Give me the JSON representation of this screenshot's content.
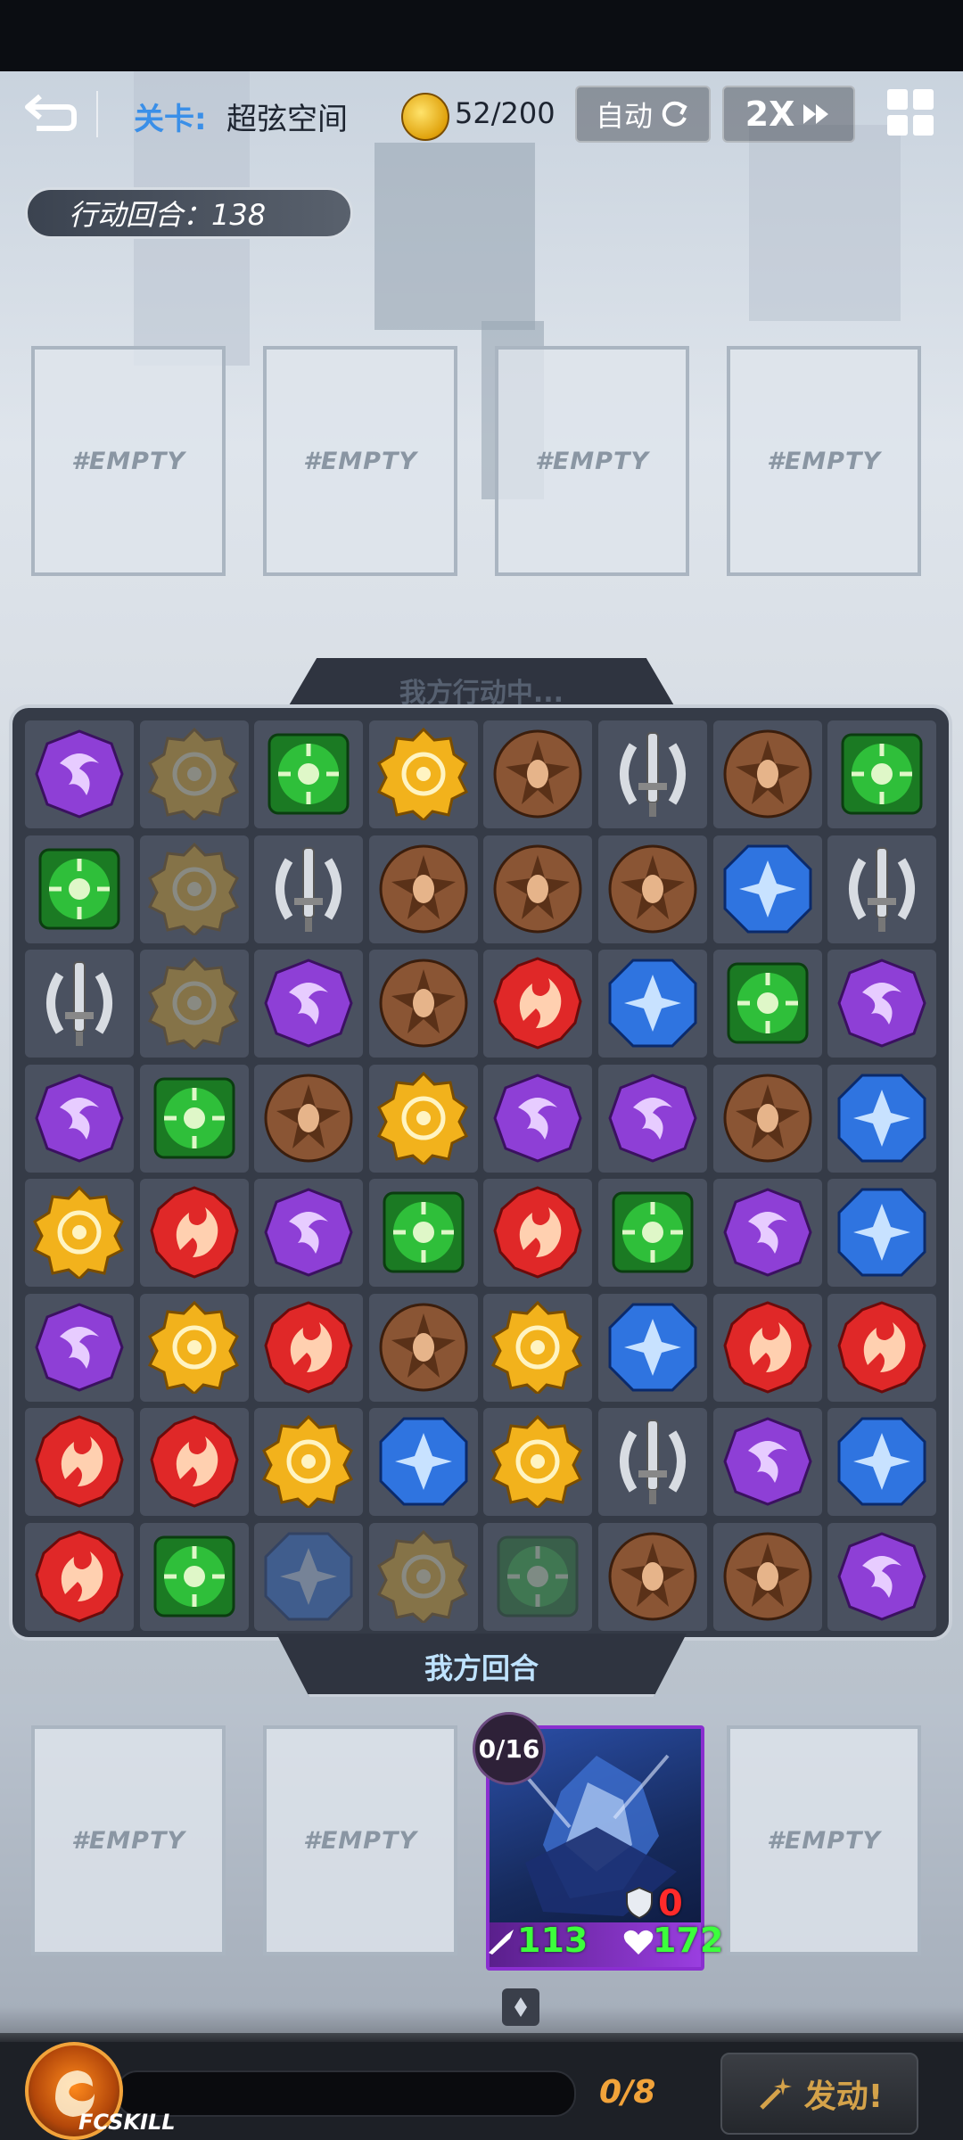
{
  "header": {
    "level_label": "关卡:",
    "level_name": "超弦空间",
    "coins": "52/200",
    "auto_label": "自动",
    "speed_label": "2X"
  },
  "turn_counter": "行动回合：138",
  "enemy_slots": [
    "#EMPTY",
    "#EMPTY",
    "#EMPTY",
    "#EMPTY"
  ],
  "board": {
    "status_top": "我方行动中...",
    "status_bottom": "我方回合",
    "rows": [
      [
        "purple",
        "yellow-faded",
        "green",
        "yellow",
        "brown",
        "silver",
        "brown",
        "green"
      ],
      [
        "green",
        "yellow-faded",
        "silver",
        "brown",
        "brown",
        "brown",
        "blue",
        "silver"
      ],
      [
        "silver",
        "yellow-faded",
        "purple",
        "brown",
        "red",
        "blue",
        "green",
        "purple"
      ],
      [
        "purple",
        "green",
        "brown",
        "yellow",
        "purple",
        "purple",
        "brown",
        "blue"
      ],
      [
        "yellow",
        "red",
        "purple",
        "green",
        "red",
        "green",
        "purple",
        "blue"
      ],
      [
        "purple",
        "yellow",
        "red",
        "brown",
        "yellow",
        "blue",
        "red",
        "red"
      ],
      [
        "red",
        "red",
        "yellow",
        "blue",
        "yellow",
        "silver",
        "purple",
        "blue"
      ],
      [
        "red",
        "green",
        "blue-faded",
        "yellow-faded",
        "green-faded",
        "brown",
        "brown",
        "purple"
      ]
    ]
  },
  "party_slots": [
    "#EMPTY",
    "#EMPTY",
    "hero",
    "#EMPTY"
  ],
  "hero": {
    "charge": "0/16",
    "attack": "113",
    "shield": "0",
    "hp": "172"
  },
  "skill_bar": {
    "label": "FCSKILL",
    "count": "0/8",
    "progress": 0,
    "launch_label": "发动!"
  },
  "colors": {
    "purple": "#8e3fd6",
    "green": "#2fbf3a",
    "yellow": "#f2b21c",
    "brown": "#8a5534",
    "red": "#e02828",
    "blue": "#2f74e0",
    "silver": "#d8dce2"
  }
}
